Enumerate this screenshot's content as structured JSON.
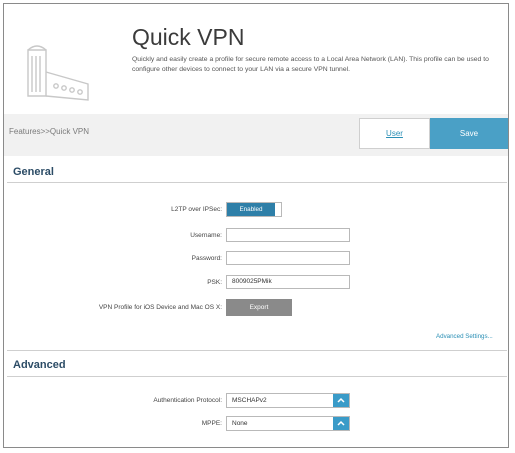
{
  "header": {
    "title": "Quick VPN",
    "description": "Quickly and easily create a profile for secure remote access to a Local Area Network (LAN). This profile can be used to configure other devices to connect to your LAN via a secure VPN tunnel."
  },
  "breadcrumb": "Features>>Quick VPN",
  "toolbar": {
    "user_label": "User",
    "save_label": "Save"
  },
  "general": {
    "title": "General",
    "l2tp_label": "L2TP over IPSec:",
    "l2tp_state": "Enabled",
    "username_label": "Username:",
    "username_value": "",
    "password_label": "Password:",
    "password_value": "",
    "psk_label": "PSK:",
    "psk_value": "8009025PMik",
    "vpn_profile_label": "VPN Profile for iOS Device and Mac OS X:",
    "export_label": "Export",
    "advanced_settings_link": "Advanced Settings..."
  },
  "advanced": {
    "title": "Advanced",
    "auth_label": "Authentication Protocol:",
    "auth_value": "MSCHAPv2",
    "mppe_label": "MPPE:",
    "mppe_value": "None"
  },
  "icons": {
    "logo": "router-logo-icon",
    "select_toggle": "chevron-up-icon"
  },
  "colors": {
    "accent": "#4aa0c6",
    "toggle_on": "#2e7fa8",
    "section_title": "#2c4c66",
    "link": "#2a8fb5",
    "export_button": "#8a8a8a"
  }
}
